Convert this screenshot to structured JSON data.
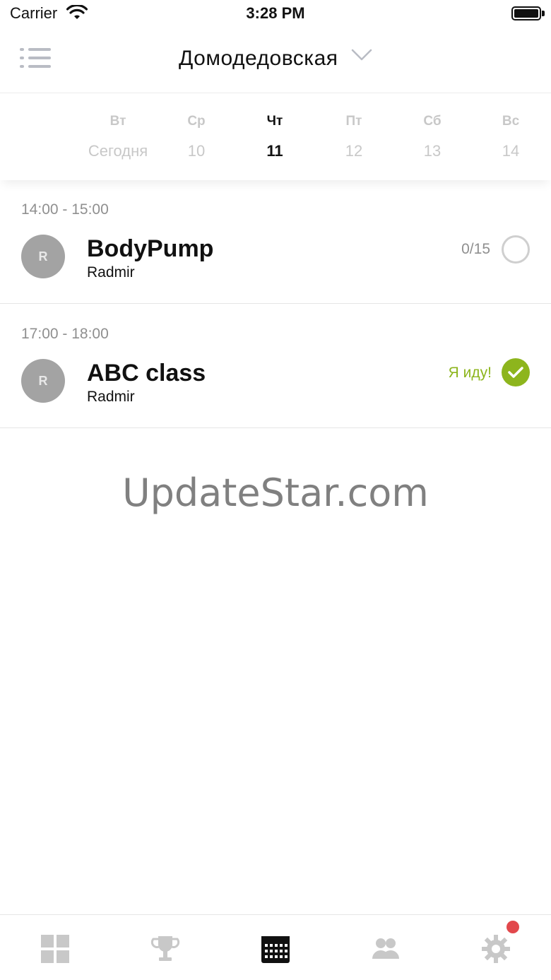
{
  "status_bar": {
    "carrier": "Carrier",
    "time": "3:28 PM"
  },
  "header": {
    "club_name": "Домодедовская"
  },
  "week": [
    {
      "name": "Вт",
      "label": "Сегодня",
      "active": false
    },
    {
      "name": "Ср",
      "label": "10",
      "active": false
    },
    {
      "name": "Чт",
      "label": "11",
      "active": true
    },
    {
      "name": "Пт",
      "label": "12",
      "active": false
    },
    {
      "name": "Сб",
      "label": "13",
      "active": false
    },
    {
      "name": "Вс",
      "label": "14",
      "active": false
    }
  ],
  "classes": [
    {
      "time": "14:00 - 15:00",
      "avatar_initial": "R",
      "title": "BodyPump",
      "trainer": "Radmir",
      "capacity": "0/15",
      "status": "not-booked"
    },
    {
      "time": "17:00 - 18:00",
      "avatar_initial": "R",
      "title": "ABC class",
      "trainer": "Radmir",
      "going_label": "Я иду!",
      "status": "booked"
    }
  ],
  "watermark": "UpdateStar.com",
  "tabs": [
    {
      "icon": "grid-icon",
      "active": false
    },
    {
      "icon": "trophy-icon",
      "active": false
    },
    {
      "icon": "calendar-icon",
      "active": true
    },
    {
      "icon": "users-icon",
      "active": false
    },
    {
      "icon": "gear-icon",
      "active": false,
      "badge": true
    }
  ],
  "colors": {
    "accent_green": "#8db51d",
    "badge_red": "#e2484c",
    "inactive_gray": "#c8c8c8",
    "icon_gray": "#b9bcc4"
  }
}
